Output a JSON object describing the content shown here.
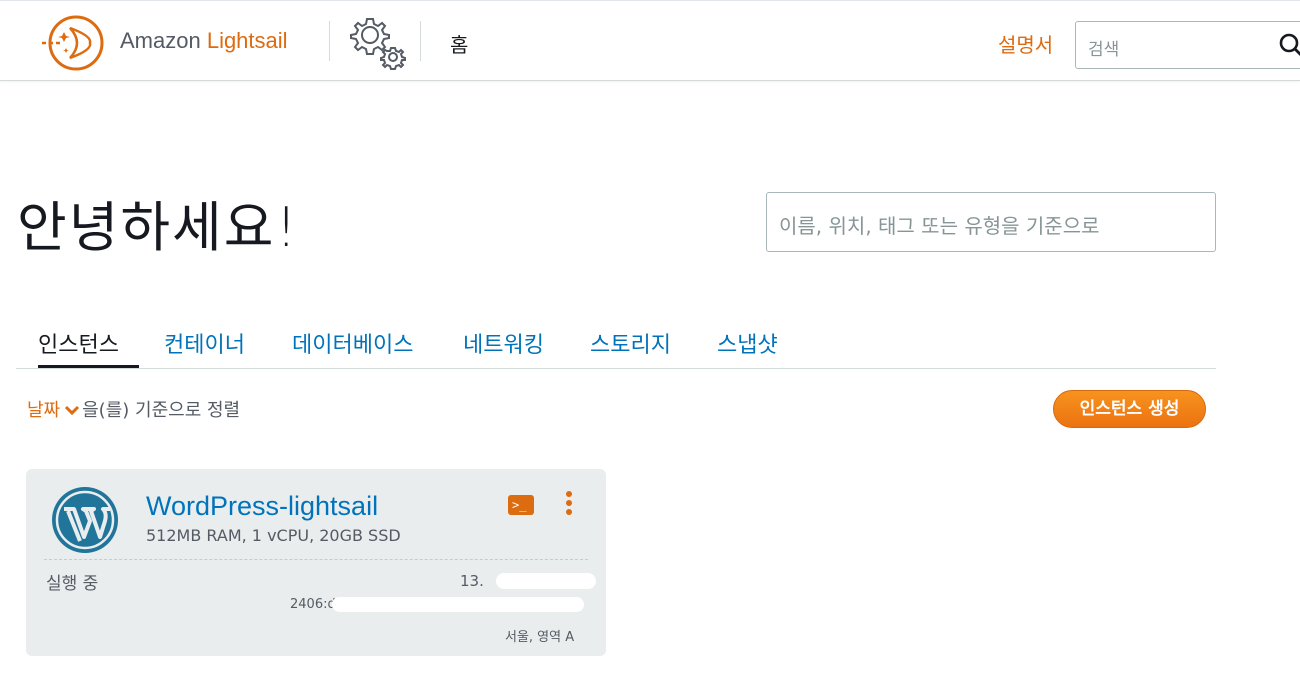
{
  "header": {
    "brand_prefix": "Amazon ",
    "brand_accent": "Lightsail",
    "home_label": "홈",
    "docs_label": "설명서",
    "search_placeholder": "검색"
  },
  "main": {
    "greeting": "안녕하세요!",
    "filter_placeholder": "이름, 위치, 태그 또는 유형을 기준으로",
    "tabs": [
      {
        "label": "인스턴스",
        "active": true
      },
      {
        "label": "컨테이너",
        "active": false
      },
      {
        "label": "데이터베이스",
        "active": false
      },
      {
        "label": "네트워킹",
        "active": false
      },
      {
        "label": "스토리지",
        "active": false
      },
      {
        "label": "스냅샷",
        "active": false
      }
    ],
    "sort": {
      "key": "날짜",
      "suffix": "을(를) 기준으로 정렬"
    },
    "create_button": "인스턴스 생성"
  },
  "instance": {
    "name": "WordPress-lightsail",
    "spec": "512MB RAM, 1 vCPU, 20GB SSD",
    "state": "실행 중",
    "ipv4": "13.",
    "ipv6": "2406:d",
    "region": "서울, 영역 A",
    "terminal_label": ">_"
  },
  "colors": {
    "accent": "#dd6b10",
    "link": "#0073bb",
    "card_bg": "#eaeded"
  },
  "icons": {
    "logo": "lightsail-logo-icon",
    "settings": "gears-icon",
    "search": "search-icon",
    "app": "wordpress-icon",
    "terminal": "terminal-icon",
    "menu": "kebab-menu-icon",
    "sort": "chevron-down-icon"
  }
}
